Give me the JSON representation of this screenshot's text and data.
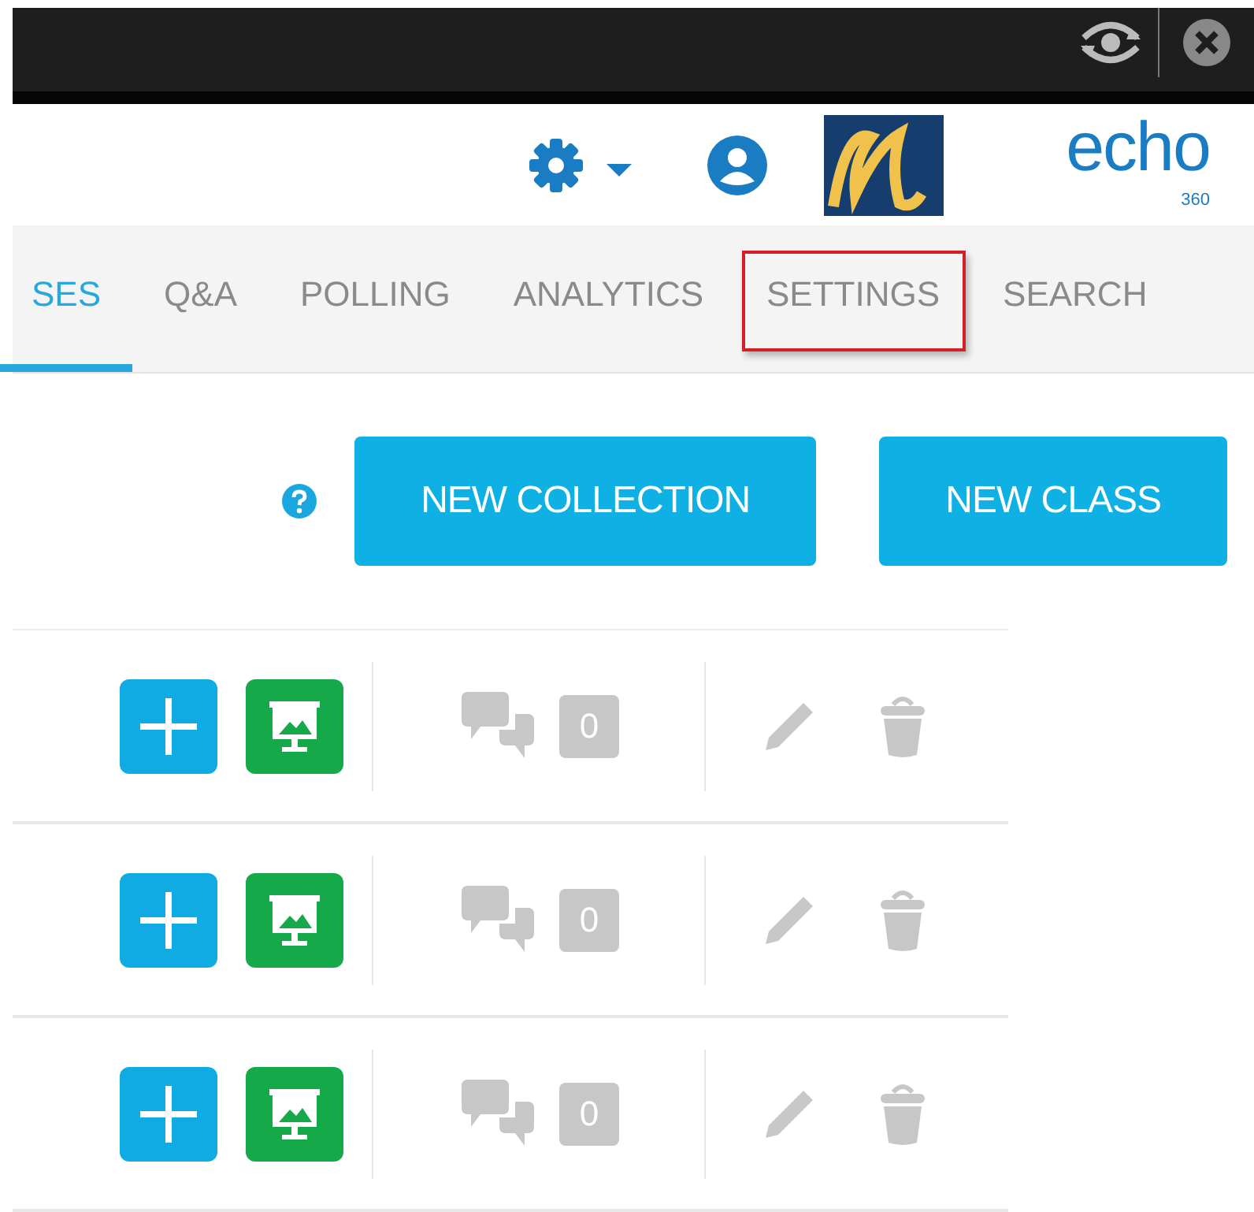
{
  "header": {
    "brand": "echo",
    "brand_superscript": "360"
  },
  "tabs": [
    {
      "label": "SES",
      "selected": true,
      "highlighted": false
    },
    {
      "label": "Q&A",
      "selected": false,
      "highlighted": false
    },
    {
      "label": "POLLING",
      "selected": false,
      "highlighted": false
    },
    {
      "label": "ANALYTICS",
      "selected": false,
      "highlighted": false
    },
    {
      "label": "SETTINGS",
      "selected": false,
      "highlighted": true
    },
    {
      "label": "SEARCH",
      "selected": false,
      "highlighted": false
    }
  ],
  "actions": [
    "NEW COLLECTION",
    "NEW CLASS"
  ],
  "rows": [
    {
      "count": "0"
    },
    {
      "count": "0"
    },
    {
      "count": "0"
    }
  ]
}
